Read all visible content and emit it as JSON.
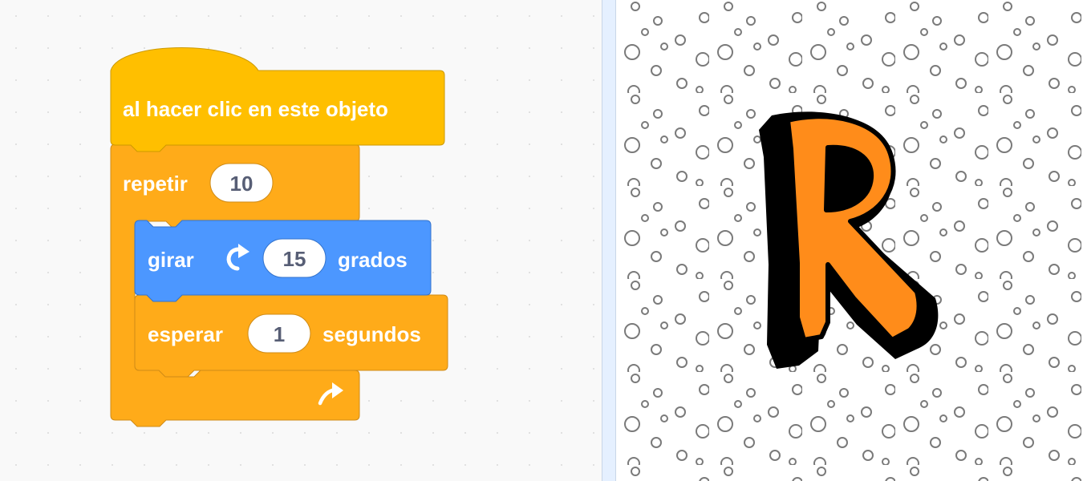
{
  "script": {
    "hat_block": {
      "label": "al hacer clic en este objeto"
    },
    "repeat_block": {
      "label": "repetir",
      "count": "10"
    },
    "turn_block": {
      "label_before": "girar",
      "icon": "rotate-right-icon",
      "degrees": "15",
      "label_after": "grados"
    },
    "wait_block": {
      "label_before": "esperar",
      "seconds": "1",
      "label_after": "segundos"
    },
    "loop_arrow": {
      "icon": "loop-arrow-icon"
    }
  },
  "stage": {
    "sprite_letter": "R",
    "backdrop": "polka-dot circles"
  },
  "colors": {
    "events": "#ffbf00",
    "control": "#ffab19",
    "motion": "#4c97ff",
    "workspace": "#f9f9f9",
    "divider": "#e5f0ff",
    "sprite_fill": "#ff8c1a",
    "sprite_outline": "#000000"
  }
}
